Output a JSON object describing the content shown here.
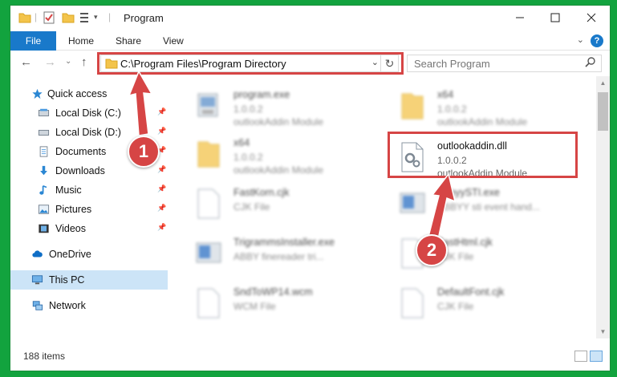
{
  "window": {
    "title": "Program"
  },
  "ribbon": {
    "tabs": [
      {
        "label": "File"
      },
      {
        "label": "Home"
      },
      {
        "label": "Share"
      },
      {
        "label": "View"
      }
    ]
  },
  "nav": {
    "address": "C:\\Program Files\\Program Directory",
    "search_placeholder": "Search Program"
  },
  "sidebar": {
    "items": [
      {
        "label": "Quick access",
        "icon": "star-icon"
      },
      {
        "label": "Local Disk (C:)",
        "icon": "drive-icon"
      },
      {
        "label": "Local Disk (D:)",
        "icon": "drive-icon"
      },
      {
        "label": "Documents",
        "icon": "documents-icon"
      },
      {
        "label": "Downloads",
        "icon": "download-icon"
      },
      {
        "label": "Music",
        "icon": "music-icon"
      },
      {
        "label": "Pictures",
        "icon": "pictures-icon"
      },
      {
        "label": "Videos",
        "icon": "videos-icon"
      },
      {
        "label": "OneDrive",
        "icon": "cloud-icon"
      },
      {
        "label": "This PC",
        "icon": "computer-icon"
      },
      {
        "label": "Network",
        "icon": "network-icon"
      }
    ]
  },
  "files": [
    {
      "name": "program.exe",
      "line2": "1.0.0.2",
      "line3": "outlookAddin Module",
      "icon": "exe-icon"
    },
    {
      "name": "x64",
      "line2": "1.0.0.2",
      "line3": "outlookAddin Module",
      "icon": "folder-icon"
    },
    {
      "name": "x64",
      "line2": "1.0.0.2",
      "line3": "outlookAddin Module",
      "icon": "folder-icon"
    },
    {
      "name": "outlookaddin.dll",
      "line2": "1.0.0.2",
      "line3": "outlookAddin Module",
      "icon": "dll-icon"
    },
    {
      "name": "FastKorn.cjk",
      "line2": "CJK File",
      "line3": "",
      "icon": "file-icon"
    },
    {
      "name": "AbbyySTI.exe",
      "line2": "ABBYY sti event hand...",
      "line3": "",
      "icon": "exe-icon"
    },
    {
      "name": "TrigrammsInstaller.exe",
      "line2": "ABBY finereader tri...",
      "line3": "",
      "icon": "exe-icon"
    },
    {
      "name": "FastHtml.cjk",
      "line2": "CJK File",
      "line3": "",
      "icon": "file-icon"
    },
    {
      "name": "SndToWP14.wcm",
      "line2": "WCM File",
      "line3": "",
      "icon": "file-icon"
    },
    {
      "name": "DefaultFont.cjk",
      "line2": "CJK File",
      "line3": "",
      "icon": "file-icon"
    }
  ],
  "status": {
    "item_count": "188 items"
  },
  "annotations": [
    {
      "label": "1"
    },
    {
      "label": "2"
    }
  ],
  "colors": {
    "accent": "#1979ca",
    "annotation": "#d64545",
    "background": "#12a33e"
  }
}
